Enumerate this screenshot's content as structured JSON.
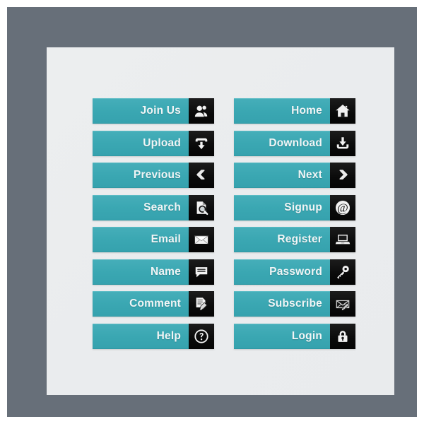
{
  "colors": {
    "outer_white": "#ffffff",
    "frame_slate": "#676f79",
    "panel_light": "#ebedee",
    "button_teal": "#3ba8b4",
    "icon_black": "#0d0d0d",
    "label_text": "#f0f5f6"
  },
  "buttons": {
    "left_column": [
      {
        "label": "Join Us",
        "icon": "users-icon"
      },
      {
        "label": "Upload",
        "icon": "upload-arrow-icon"
      },
      {
        "label": "Previous",
        "icon": "arrow-left-icon"
      },
      {
        "label": "Search",
        "icon": "document-magnifier-icon"
      },
      {
        "label": "Email",
        "icon": "envelope-icon"
      },
      {
        "label": "Name",
        "icon": "speech-bubble-icon"
      },
      {
        "label": "Comment",
        "icon": "document-pen-icon"
      },
      {
        "label": "Help",
        "icon": "question-mark-circle-icon"
      }
    ],
    "right_column": [
      {
        "label": "Home",
        "icon": "house-icon"
      },
      {
        "label": "Download",
        "icon": "download-arrow-icon"
      },
      {
        "label": "Next",
        "icon": "arrow-right-icon"
      },
      {
        "label": "Signup",
        "icon": "at-sign-icon"
      },
      {
        "label": "Register",
        "icon": "laptop-icon"
      },
      {
        "label": "Password",
        "icon": "key-icon"
      },
      {
        "label": "Subscribe",
        "icon": "envelope-pen-icon"
      },
      {
        "label": "Login",
        "icon": "padlock-icon"
      }
    ]
  }
}
